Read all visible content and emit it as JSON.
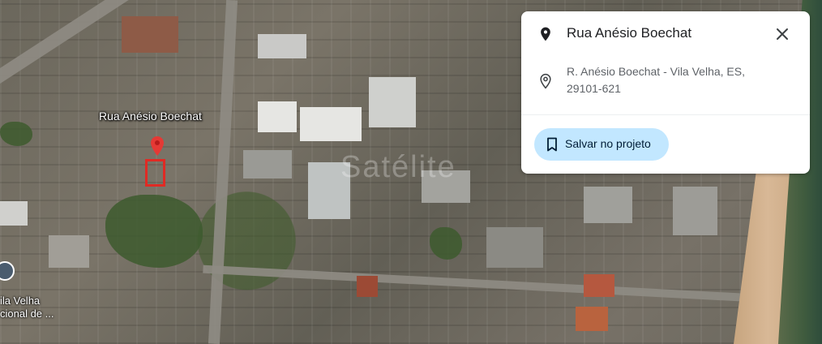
{
  "map": {
    "street_label": "Rua Anésio Boechat",
    "place_label_line1": "ila Velha",
    "place_label_line2": "cional de ...",
    "watermark": "Satélite",
    "colors": {
      "parcel_border": "#e02a24",
      "pin": "#e53935"
    }
  },
  "info_card": {
    "title": "Rua Anésio Boechat",
    "title_icon": "location-pin-icon",
    "close_icon": "close-icon",
    "address_line1": "R. Anésio Boechat - Vila Velha, ES,",
    "address_line2": "29101-621",
    "address_icon": "location-pin-icon",
    "save_button_label": "Salvar no projeto",
    "save_button_icon": "bookmark-icon",
    "colors": {
      "save_button_bg": "#c2e7ff",
      "title": "#202124",
      "address": "#5f6368"
    }
  }
}
